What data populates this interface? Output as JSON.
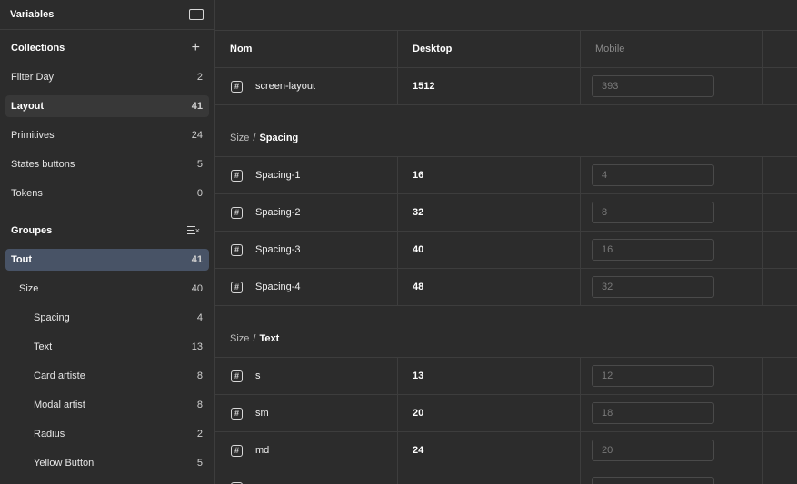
{
  "sidebar": {
    "title": "Variables",
    "collections_title": "Collections",
    "collections": [
      {
        "label": "Filter Day",
        "count": "2"
      },
      {
        "label": "Layout",
        "count": "41"
      },
      {
        "label": "Primitives",
        "count": "24"
      },
      {
        "label": "States buttons",
        "count": "5"
      },
      {
        "label": "Tokens",
        "count": "0"
      }
    ],
    "groups_title": "Groupes",
    "groups": [
      {
        "label": "Tout",
        "count": "41"
      },
      {
        "label": "Size",
        "count": "40"
      },
      {
        "label": "Spacing",
        "count": "4"
      },
      {
        "label": "Text",
        "count": "13"
      },
      {
        "label": "Card artiste",
        "count": "8"
      },
      {
        "label": "Modal artist",
        "count": "8"
      },
      {
        "label": "Radius",
        "count": "2"
      },
      {
        "label": "Yellow Button",
        "count": "5"
      }
    ]
  },
  "table": {
    "headers": {
      "name": "Nom",
      "desktop": "Desktop",
      "mobile": "Mobile"
    },
    "top_row": {
      "name": "screen-layout",
      "desktop": "1512",
      "mobile": "393"
    },
    "groups": [
      {
        "parent": "Size",
        "sep": "/",
        "child": "Spacing",
        "rows": [
          {
            "name": "Spacing-1",
            "desktop": "16",
            "mobile": "4"
          },
          {
            "name": "Spacing-2",
            "desktop": "32",
            "mobile": "8"
          },
          {
            "name": "Spacing-3",
            "desktop": "40",
            "mobile": "16"
          },
          {
            "name": "Spacing-4",
            "desktop": "48",
            "mobile": "32"
          }
        ]
      },
      {
        "parent": "Size",
        "sep": "/",
        "child": "Text",
        "rows": [
          {
            "name": "s",
            "desktop": "13",
            "mobile": "12"
          },
          {
            "name": "sm",
            "desktop": "20",
            "mobile": "18"
          },
          {
            "name": "md",
            "desktop": "24",
            "mobile": "20"
          }
        ]
      }
    ]
  },
  "icons": {
    "number_glyph": "#"
  },
  "colors": {
    "selected_blue": "#485366",
    "selected_grey": "#383838",
    "background": "#2c2c2c",
    "border": "#3d3d3d"
  }
}
